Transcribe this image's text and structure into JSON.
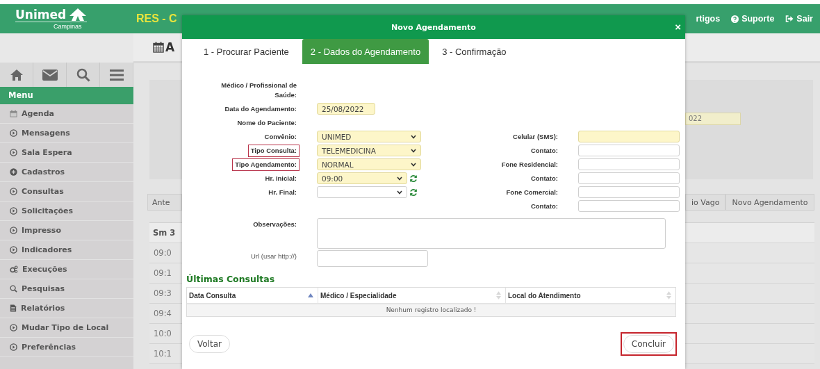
{
  "header": {
    "logo": "Unimed",
    "logo_sub": "Campinas",
    "system_title": "RES - C",
    "links": [
      {
        "label": "rtigos",
        "kind": "plain"
      },
      {
        "label": "Suporte",
        "kind": "help"
      },
      {
        "label": "Sair",
        "kind": "exit"
      }
    ]
  },
  "sidebar": {
    "menu_title": "Menu",
    "items": [
      {
        "label": "Agenda",
        "kind": "calendar"
      },
      {
        "label": "Mensagens",
        "kind": "module"
      },
      {
        "label": "Sala Espera",
        "kind": "module"
      },
      {
        "label": "Cadastros",
        "kind": "add"
      },
      {
        "label": "Consultas",
        "kind": "module"
      },
      {
        "label": "Solicitações",
        "kind": "module"
      },
      {
        "label": "Impresso",
        "kind": "module"
      },
      {
        "label": "Indicadores",
        "kind": "module"
      },
      {
        "label": "Execuções",
        "kind": "process"
      },
      {
        "label": "Pesquisas",
        "kind": "search"
      },
      {
        "label": "Relatórios",
        "kind": "report"
      },
      {
        "label": "Mudar Tipo de Local",
        "kind": "module"
      },
      {
        "label": "Preferências",
        "kind": "module"
      }
    ]
  },
  "page": {
    "title": "A",
    "date_value": "022",
    "prev_button": "Ante",
    "buttons": [
      "io Vago",
      "Novo Agendamento"
    ],
    "day_header": "Sm 3",
    "times": [
      "09:0",
      "09:1",
      "09:3",
      "09:4",
      "10:0",
      "10:1"
    ]
  },
  "dialog": {
    "title": "Novo Agendamento",
    "close": "×",
    "steps": [
      {
        "label": "1 - Procurar Paciente",
        "selected": false
      },
      {
        "label": "2 - Dados do Agendamento",
        "selected": true
      },
      {
        "label": "3 - Confirmação",
        "selected": false
      }
    ],
    "form_rows": [
      {
        "left": {
          "label": "Médico / Profissional de Saúde:",
          "kind": "static",
          "highlighted": false
        }
      },
      {
        "left": {
          "label": "Data do Agendamento:",
          "kind": "date",
          "value": "25/08/2022",
          "required": true,
          "highlighted": false
        }
      },
      {
        "left": {
          "label": "Nome do Paciente:",
          "kind": "static",
          "highlighted": false
        }
      },
      {
        "left": {
          "label": "Convênio:",
          "kind": "select",
          "value": "UNIMED",
          "required": true,
          "highlighted": false
        },
        "right": {
          "label": "Celular (SMS):",
          "kind": "text",
          "required": true,
          "highlighted": false
        }
      },
      {
        "left": {
          "label": "Tipo Consulta:",
          "kind": "select",
          "value": "TELEMEDICINA",
          "required": true,
          "highlighted": true
        },
        "right": {
          "label": "Contato:",
          "kind": "text",
          "required": false,
          "highlighted": false
        }
      },
      {
        "left": {
          "label": "Tipo Agendamento:",
          "kind": "select",
          "value": "NORMAL",
          "required": true,
          "highlighted": true
        },
        "right": {
          "label": "Fone Residencial:",
          "kind": "text",
          "required": false,
          "highlighted": false
        }
      },
      {
        "left": {
          "label": "Hr. Inicial:",
          "kind": "time",
          "value": "09:00",
          "required": true,
          "highlighted": false
        },
        "right": {
          "label": "Contato:",
          "kind": "text",
          "required": false,
          "highlighted": false
        }
      },
      {
        "left": {
          "label": "Hr. Final:",
          "kind": "time",
          "required": false,
          "highlighted": false
        },
        "right": {
          "label": "Fone Comercial:",
          "kind": "text",
          "required": false,
          "highlighted": false
        }
      },
      {
        "right": {
          "label": "Contato:",
          "kind": "text",
          "required": false,
          "highlighted": false
        }
      }
    ],
    "notes_label": "Observações:",
    "url_label": "Url (usar http://)",
    "history": {
      "title": "Últimas Consultas",
      "columns": [
        {
          "label": "Data Consulta",
          "kind": "sorted"
        },
        {
          "label": "Médico / Especialidade",
          "kind": "sortable"
        },
        {
          "label": "Local do Atendimento",
          "kind": "sortable"
        }
      ],
      "empty": "Nenhum registro localizado !"
    },
    "buttons": [
      {
        "label": "Voltar",
        "highlighted": false
      },
      {
        "label": "Concluir",
        "highlighted": true
      }
    ]
  }
}
